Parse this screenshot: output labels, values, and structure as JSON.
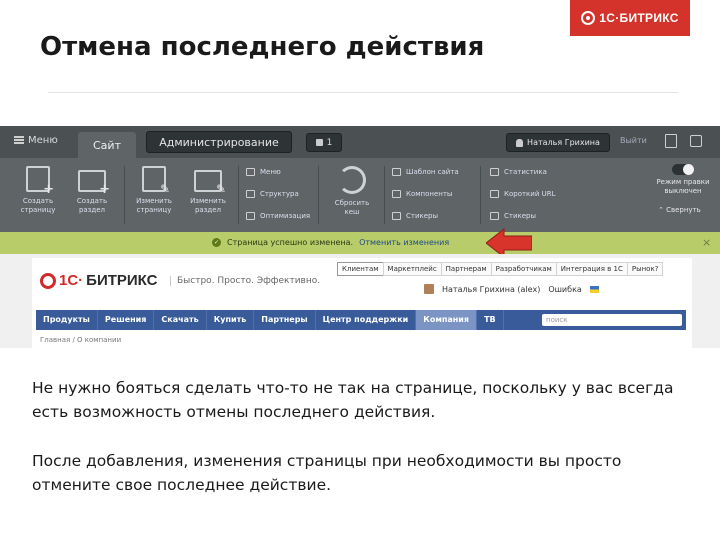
{
  "slide": {
    "logo": "1С·БИТРИКС",
    "title": "Отмена последнего действия",
    "paragraphs": [
      "Не нужно бояться сделать что-то не так на странице, поскольку у вас всегда есть возможность отмены последнего действия.",
      "После добавления, изменения страницы при необходимости вы просто отмените свое последнее действие."
    ]
  },
  "admin_panel": {
    "menu_label": "Меню",
    "tab_site": "Сайт",
    "tab_admin": "Администрирование",
    "notifications_count": "1",
    "user_name": "Наталья Грихина",
    "exit_label": "Выйти",
    "tools": [
      {
        "label": "Создать страницу"
      },
      {
        "label": "Создать раздел"
      },
      {
        "label": "Изменить страницу"
      },
      {
        "label": "Изменить раздел"
      }
    ],
    "list_col1": [
      "Меню",
      "Структура",
      "Оптимизация"
    ],
    "refresh_label": "Сбросить кеш",
    "list_col2": [
      "Шаблон сайта",
      "Компоненты",
      "Стикеры"
    ],
    "list_col3": [
      "Статистика",
      "Короткий URL",
      "Стикеры"
    ],
    "edit_mode_label": "Режим правки выключен",
    "collapse_label": "Свернуть",
    "notify_text": "Страница успешно изменена.",
    "undo_link": "Отменить изменения",
    "colors": {
      "topbar": "#4b5052",
      "toolbar": "#5f6567",
      "notify": "#b8cc6a",
      "arrow": "#d9342b"
    }
  },
  "site": {
    "logo_left": "1С·",
    "logo_right": "БИТРИКС",
    "slogan": "Быстро. Просто. Эффективно.",
    "top_links": [
      "Клиентам",
      "Маркетплейс",
      "Партнерам",
      "Разработчикам",
      "Интеграция в 1С",
      "Рынок?"
    ],
    "user_line": "Наталья Грихина (alex)",
    "status": "Ошибка",
    "main_nav": [
      "Продукты",
      "Решения",
      "Скачать",
      "Купить",
      "Партнеры",
      "Центр поддержки",
      "Компания",
      "ТВ"
    ],
    "active_nav": "Компания",
    "search_placeholder": "поиск",
    "breadcrumbs": "Главная / О компании"
  }
}
